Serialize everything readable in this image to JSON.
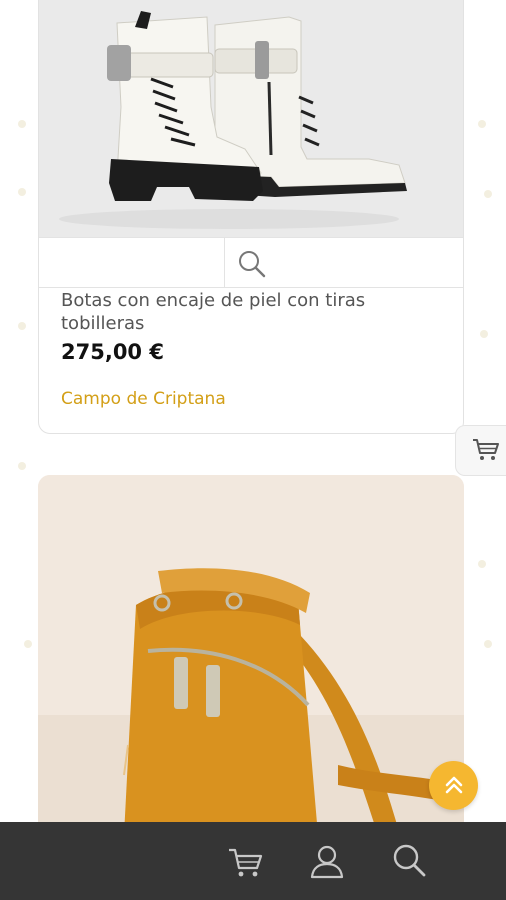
{
  "products": [
    {
      "title": "Botas con encaje de piel con tiras tobilleras",
      "price": "275,00 €",
      "location": "Campo de Criptana",
      "image": "white-leather-lace-up-boots"
    },
    {
      "image": "mustard-leather-crossbody-bag"
    }
  ],
  "icons": {
    "zoom": "magnifier-icon",
    "side_cart": "cart-icon",
    "scroll_top": "double-chevron-up-icon",
    "nav_cart": "cart-icon",
    "nav_account": "user-icon",
    "nav_search": "search-icon"
  },
  "colors": {
    "accent": "#d39f17",
    "scroll_button": "#f5b730",
    "bottom_bar": "#353535"
  }
}
